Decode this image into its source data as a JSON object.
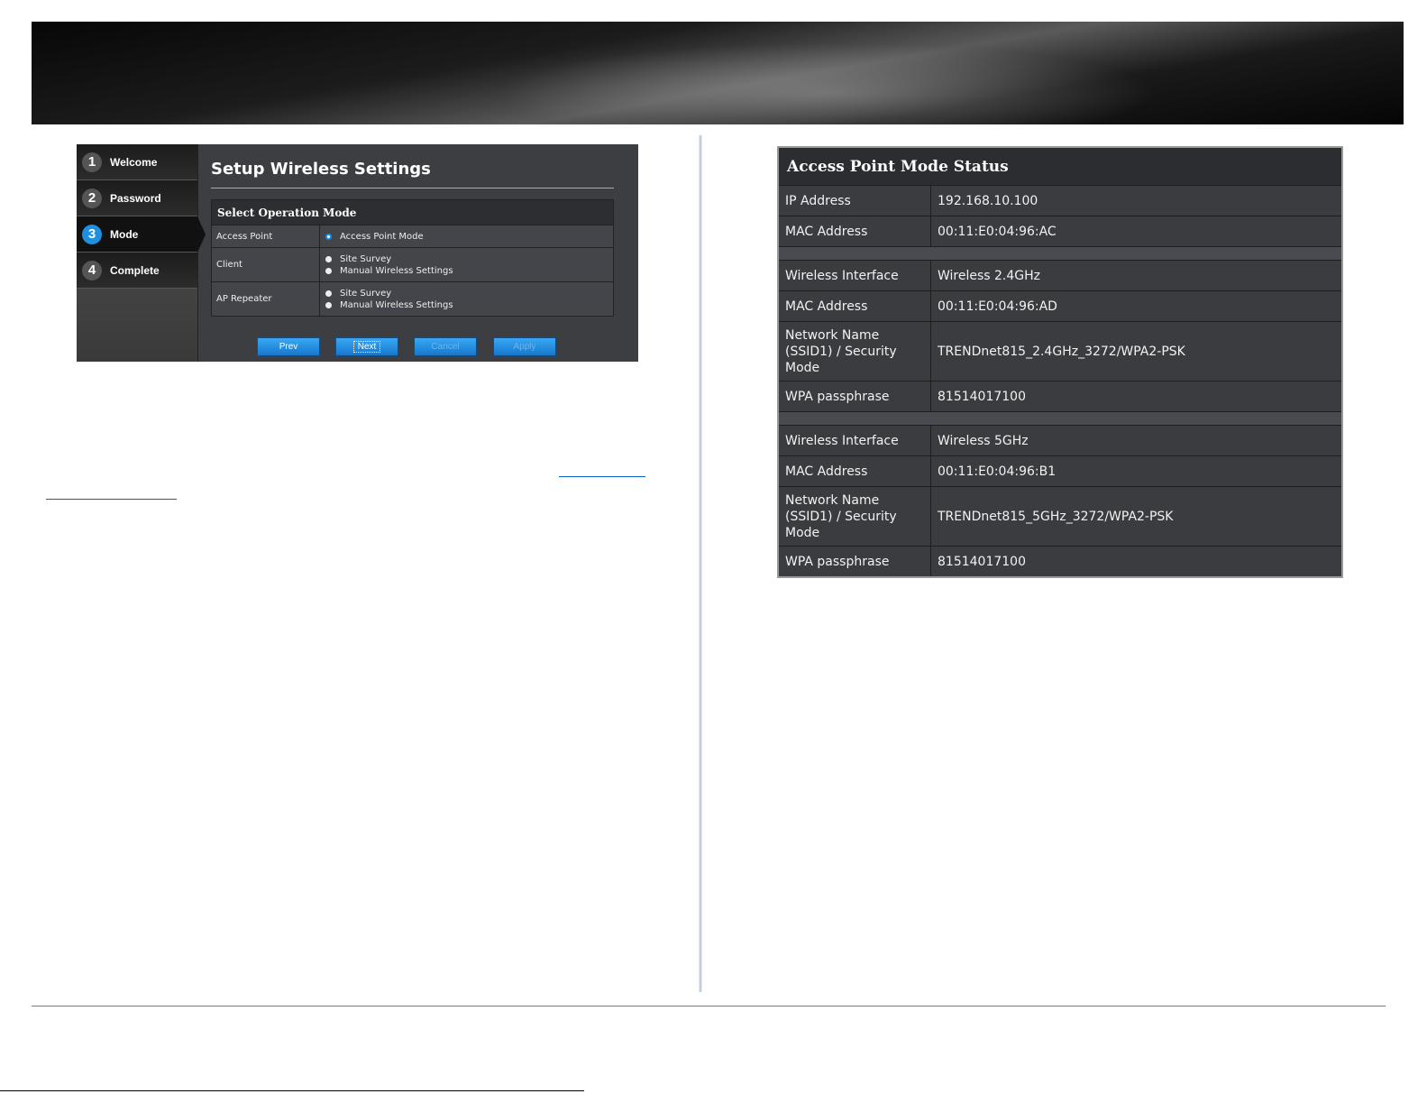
{
  "wizard": {
    "steps": [
      {
        "num": "1",
        "label": "Welcome"
      },
      {
        "num": "2",
        "label": "Password"
      },
      {
        "num": "3",
        "label": "Mode"
      },
      {
        "num": "4",
        "label": "Complete"
      }
    ],
    "active_step": 3,
    "title": "Setup Wireless Settings",
    "table_title": "Select Operation Mode",
    "modes": [
      {
        "label": "Access Point",
        "options": [
          {
            "text": "Access Point Mode",
            "selected": true
          }
        ]
      },
      {
        "label": "Client",
        "options": [
          {
            "text": "Site Survey",
            "selected": false
          },
          {
            "text": "Manual Wireless Settings",
            "selected": false
          }
        ]
      },
      {
        "label": "AP Repeater",
        "options": [
          {
            "text": "Site Survey",
            "selected": false
          },
          {
            "text": "Manual Wireless Settings",
            "selected": false
          }
        ]
      }
    ],
    "buttons": {
      "prev": "Prev",
      "next": "Next",
      "cancel": "Cancel",
      "apply": "Apply"
    }
  },
  "status": {
    "title": "Access Point Mode Status",
    "ip_label": "IP Address",
    "ip_value": "192.168.10.100",
    "mac_label": "MAC Address",
    "mac_value": "00:11:E0:04:96:AC",
    "w24": {
      "iface_label": "Wireless Interface",
      "iface_value": "Wireless 2.4GHz",
      "mac_label": "MAC Address",
      "mac_value": "00:11:E0:04:96:AD",
      "ssid_label": "Network Name (SSID1) / Security Mode",
      "ssid_value": "TRENDnet815_2.4GHz_3272/WPA2-PSK",
      "pass_label": "WPA passphrase",
      "pass_value": "81514017100"
    },
    "w5": {
      "iface_label": "Wireless Interface",
      "iface_value": "Wireless 5GHz",
      "mac_label": "MAC Address",
      "mac_value": "00:11:E0:04:96:B1",
      "ssid_label": "Network Name (SSID1) / Security Mode",
      "ssid_value": "TRENDnet815_5GHz_3272/WPA2-PSK",
      "pass_label": "WPA passphrase",
      "pass_value": "81514017100"
    }
  },
  "colors": {
    "accent": "#1f8fe0",
    "footer_rule": "#4f81bd",
    "link": "#0563c1"
  }
}
